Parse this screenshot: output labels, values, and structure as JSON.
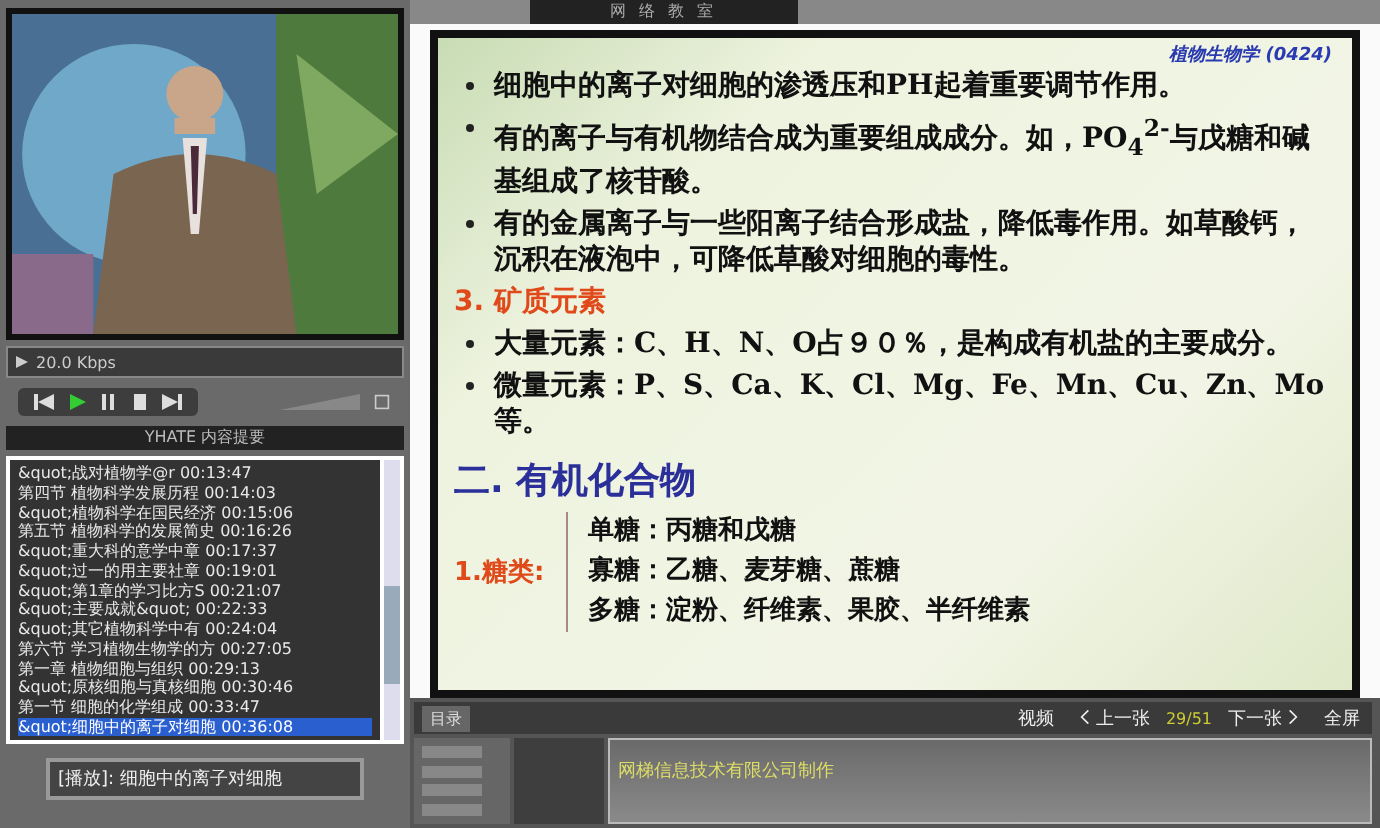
{
  "window": {
    "title": "网 络 教 室"
  },
  "video": {
    "status": "20.0 Kbps"
  },
  "player_tab": {
    "label": "YHATE 内容提要"
  },
  "chapters": [
    {
      "label": "&quot;战对植物学@r 00:13:47",
      "selected": false
    },
    {
      "label": "第四节 植物科学发展历程 00:14:03",
      "selected": false
    },
    {
      "label": "&quot;植物科学在国民经济 00:15:06",
      "selected": false
    },
    {
      "label": "第五节 植物科学的发展简史 00:16:26",
      "selected": false
    },
    {
      "label": "&quot;重大科的意学中章 00:17:37",
      "selected": false
    },
    {
      "label": "&quot;过一的用主要社章 00:19:01",
      "selected": false
    },
    {
      "label": "&quot;第1章的学习比方S 00:21:07",
      "selected": false
    },
    {
      "label": "&quot;主要成就&quot; 00:22:33",
      "selected": false
    },
    {
      "label": "&quot;其它植物科学中有 00:24:04",
      "selected": false
    },
    {
      "label": "第六节 学习植物生物学的方 00:27:05",
      "selected": false
    },
    {
      "label": "第一章 植物细胞与组织 00:29:13",
      "selected": false
    },
    {
      "label": "&quot;原核细胞与真核细胞 00:30:46",
      "selected": false
    },
    {
      "label": "第一节 细胞的化学组成 00:33:47",
      "selected": false
    },
    {
      "label": "&quot;细胞中的离子对细胞 00:36:08",
      "selected": true
    }
  ],
  "now_playing": "[播放]: 细胞中的离子对细胞",
  "slide": {
    "logo": "植物生物学 (0424)",
    "blocks": [
      {
        "kind": "bullet",
        "text": "细胞中的离子对细胞的渗透压和PH起着重要调节作用。"
      },
      {
        "kind": "bullet",
        "text": "有的离子与有机物结合成为重要组成成分。如，PO$_{4}$$^{2-}$与戊糖和碱基组成了核苷酸。"
      },
      {
        "kind": "bullet",
        "text": "有的金属离子与一些阳离子结合形成盐，降低毒作用。如草酸钙，沉积在液泡中，可降低草酸对细胞的毒性。"
      },
      {
        "kind": "subheading",
        "text": "3. 矿质元素"
      },
      {
        "kind": "bullet",
        "text": "大量元素：C、H、N、O占９０％，是构成有机盐的主要成分。"
      },
      {
        "kind": "bullet",
        "text": "微量元素：P、S、Ca、K、Cl、Mg、Fe、Mn、Cu、Zn、Mo等。"
      },
      {
        "kind": "heading",
        "text": "二. 有机化合物"
      },
      {
        "kind": "group",
        "label": "1.糖类:",
        "lines": [
          "单糖：丙糖和戊糖",
          "寡糖：乙糖、麦芽糖、蔗糖",
          "多糖：淀粉、纤维素、果胶、半纤维素"
        ]
      }
    ]
  },
  "bottom": {
    "tab": "目录",
    "video_button": "视频",
    "prev": "上一张",
    "page": "29/51",
    "next": "下一张",
    "fullscreen": "全屏",
    "credit": "网梯信息技术有限公司制作"
  }
}
